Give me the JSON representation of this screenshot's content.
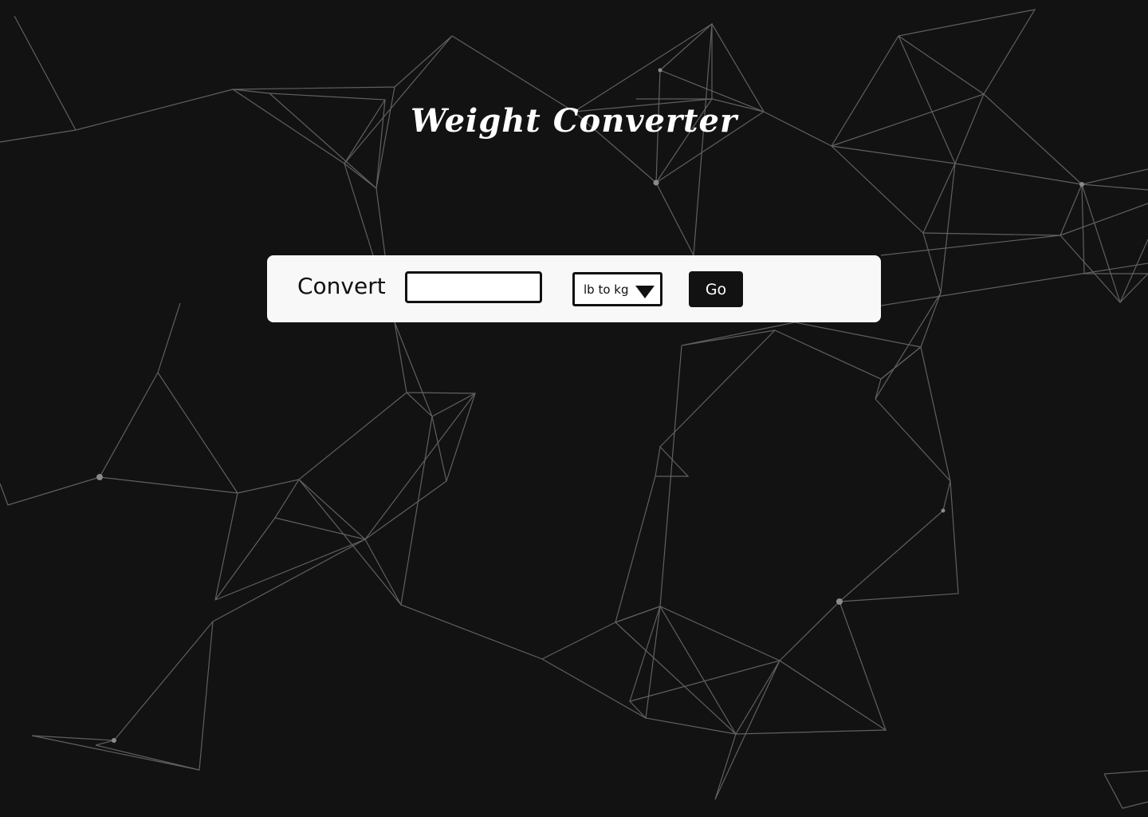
{
  "header": {
    "title": "Weight Converter"
  },
  "converter": {
    "label": "Convert",
    "input_value": "",
    "input_placeholder": "",
    "unit_selected": "lb to kg",
    "go_label": "Go"
  },
  "theme": {
    "background": "#121212",
    "panel": "#f8f8f8",
    "line_color": "#8a8a8a"
  }
}
